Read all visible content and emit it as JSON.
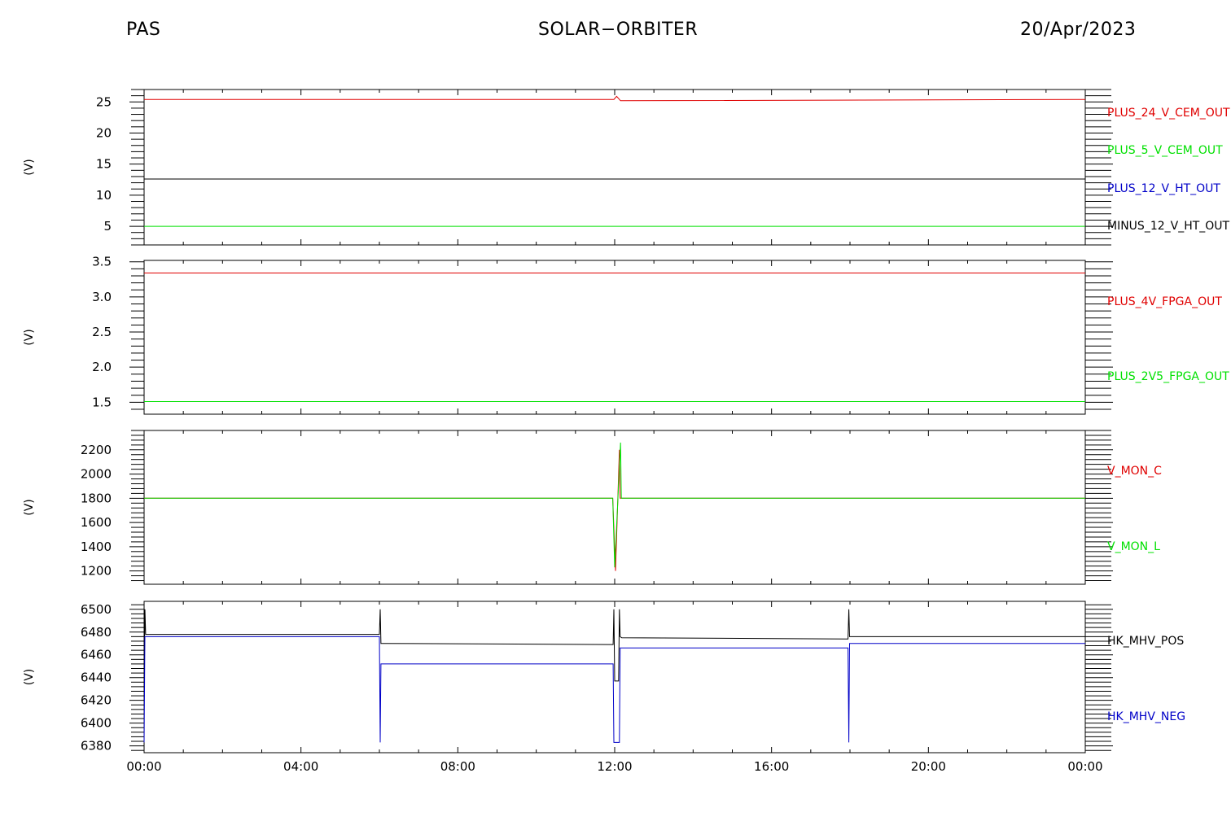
{
  "header": {
    "left": "PAS",
    "center": "SOLAR−ORBITER",
    "right": "20/Apr/2023"
  },
  "x_axis": {
    "tick_labels": [
      "00:00",
      "04:00",
      "08:00",
      "12:00",
      "16:00",
      "20:00",
      "00:00"
    ],
    "range_hours": [
      0,
      24
    ]
  },
  "colors": {
    "red": "#e00000",
    "green": "#00e000",
    "blue": "#0000c8",
    "black": "#000000"
  },
  "chart_data": [
    {
      "type": "line",
      "ylabel": "(V)",
      "ylim": [
        2,
        27
      ],
      "yticks": [
        5,
        10,
        15,
        20,
        25
      ],
      "series": [
        {
          "name": "PLUS_24_V_CEM_OUT",
          "color": "red",
          "x": [
            0,
            11.98,
            12.05,
            12.15,
            24
          ],
          "y": [
            25.4,
            25.4,
            25.9,
            25.2,
            25.4
          ]
        },
        {
          "name": "PLUS_5_V_CEM_OUT",
          "color": "green",
          "x": [
            0,
            24
          ],
          "y": [
            5.0,
            5.0
          ]
        },
        {
          "name": "PLUS_12_V_HT_OUT",
          "color": "blue",
          "x": [
            0,
            24
          ],
          "y": [
            12.6,
            12.6
          ]
        },
        {
          "name": "MINUS_12_V_HT_OUT",
          "color": "black",
          "x": [
            0,
            24
          ],
          "y": [
            12.6,
            12.6
          ]
        }
      ]
    },
    {
      "type": "line",
      "ylabel": "(V)",
      "ylim": [
        1.33,
        3.52
      ],
      "yticks": [
        1.5,
        2.0,
        2.5,
        3.0,
        3.5
      ],
      "series": [
        {
          "name": "PLUS_4V_FPGA_OUT",
          "color": "red",
          "x": [
            0,
            24
          ],
          "y": [
            3.34,
            3.34
          ]
        },
        {
          "name": "PLUS_2V5_FPGA_OUT",
          "color": "green",
          "x": [
            0,
            24
          ],
          "y": [
            1.51,
            1.51
          ]
        }
      ]
    },
    {
      "type": "line",
      "ylabel": "(V)",
      "ylim": [
        1090,
        2360
      ],
      "yticks": [
        1200,
        1400,
        1600,
        1800,
        2000,
        2200
      ],
      "series": [
        {
          "name": "V_MON_C",
          "color": "red",
          "x": [
            0,
            11.95,
            12.02,
            12.12,
            12.14,
            24
          ],
          "y": [
            1800,
            1800,
            1200,
            2200,
            1800,
            1800
          ]
        },
        {
          "name": "V_MON_L",
          "color": "green",
          "x": [
            0,
            11.95,
            12.0,
            12.15,
            12.17,
            24
          ],
          "y": [
            1800,
            1800,
            1230,
            2260,
            1800,
            1800
          ]
        }
      ]
    },
    {
      "type": "line",
      "ylabel": "(V)",
      "ylim": [
        6374,
        6507
      ],
      "yticks": [
        6380,
        6400,
        6420,
        6440,
        6460,
        6480,
        6500
      ],
      "series": [
        {
          "name": "HK_MHV_POS",
          "color": "black",
          "x": [
            0,
            0.02,
            0.04,
            0.06,
            6.0,
            6.02,
            6.04,
            6.07,
            11.96,
            11.98,
            12.0,
            12.1,
            12.12,
            12.14,
            12.18,
            17.95,
            17.97,
            17.99,
            18.03,
            24
          ],
          "y": [
            6440,
            6500,
            6478,
            6478,
            6478,
            6500,
            6470,
            6470,
            6469,
            6500,
            6437,
            6437,
            6500,
            6476,
            6475,
            6474,
            6500,
            6476,
            6476,
            6476
          ]
        },
        {
          "name": "HK_MHV_NEG",
          "color": "blue",
          "x": [
            0,
            0.02,
            0.04,
            6.0,
            6.02,
            6.04,
            6.07,
            11.96,
            11.98,
            12.0,
            12.1,
            12.12,
            12.14,
            12.18,
            17.95,
            17.97,
            17.99,
            18.03,
            24
          ],
          "y": [
            6383,
            6476,
            6476,
            6476,
            6383,
            6452,
            6452,
            6452,
            6383,
            6383,
            6383,
            6383,
            6466,
            6466,
            6466,
            6383,
            6470,
            6470,
            6470
          ]
        }
      ]
    }
  ]
}
